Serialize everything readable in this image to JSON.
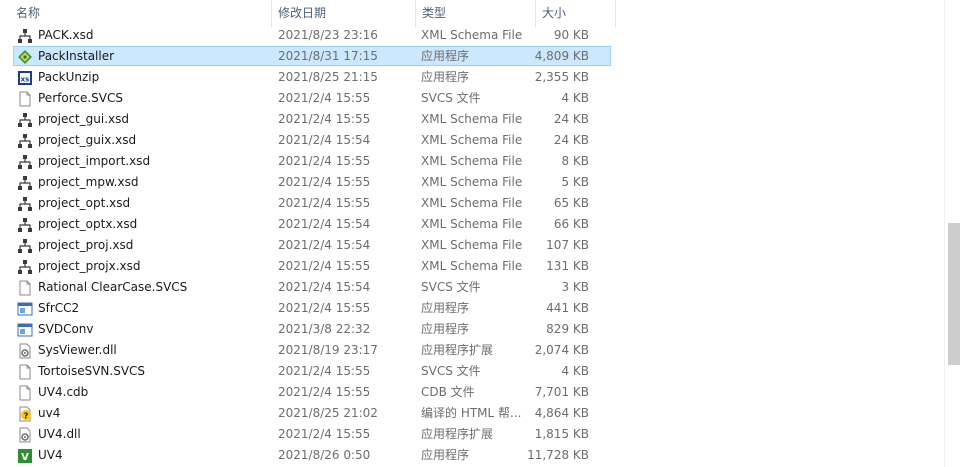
{
  "header": {
    "name_label": "名称",
    "date_label": "修改日期",
    "type_label": "类型",
    "size_label": "大小",
    "sort_indicator": "^"
  },
  "files": [
    {
      "name": "PACK.xsd",
      "date": "2021/8/23 23:16",
      "type": "XML Schema File",
      "size": "90 KB",
      "icon": "xsd-schema-icon"
    },
    {
      "name": "PackInstaller",
      "date": "2021/8/31 17:15",
      "type": "应用程序",
      "size": "4,809 KB",
      "icon": "pack-installer-icon",
      "selected": true
    },
    {
      "name": "PackUnzip",
      "date": "2021/8/25 21:15",
      "type": "应用程序",
      "size": "2,355 KB",
      "icon": "unzip-app-icon"
    },
    {
      "name": "Perforce.SVCS",
      "date": "2021/2/4 15:55",
      "type": "SVCS 文件",
      "size": "4 KB",
      "icon": "blank-file-icon"
    },
    {
      "name": "project_gui.xsd",
      "date": "2021/2/4 15:55",
      "type": "XML Schema File",
      "size": "24 KB",
      "icon": "xsd-schema-icon"
    },
    {
      "name": "project_guix.xsd",
      "date": "2021/2/4 15:54",
      "type": "XML Schema File",
      "size": "24 KB",
      "icon": "xsd-schema-icon"
    },
    {
      "name": "project_import.xsd",
      "date": "2021/2/4 15:55",
      "type": "XML Schema File",
      "size": "8 KB",
      "icon": "xsd-schema-icon"
    },
    {
      "name": "project_mpw.xsd",
      "date": "2021/2/4 15:55",
      "type": "XML Schema File",
      "size": "5 KB",
      "icon": "xsd-schema-icon"
    },
    {
      "name": "project_opt.xsd",
      "date": "2021/2/4 15:55",
      "type": "XML Schema File",
      "size": "65 KB",
      "icon": "xsd-schema-icon"
    },
    {
      "name": "project_optx.xsd",
      "date": "2021/2/4 15:54",
      "type": "XML Schema File",
      "size": "66 KB",
      "icon": "xsd-schema-icon"
    },
    {
      "name": "project_proj.xsd",
      "date": "2021/2/4 15:54",
      "type": "XML Schema File",
      "size": "107 KB",
      "icon": "xsd-schema-icon"
    },
    {
      "name": "project_projx.xsd",
      "date": "2021/2/4 15:55",
      "type": "XML Schema File",
      "size": "131 KB",
      "icon": "xsd-schema-icon"
    },
    {
      "name": "Rational ClearCase.SVCS",
      "date": "2021/2/4 15:54",
      "type": "SVCS 文件",
      "size": "3 KB",
      "icon": "blank-file-icon"
    },
    {
      "name": "SfrCC2",
      "date": "2021/2/4 15:55",
      "type": "应用程序",
      "size": "441 KB",
      "icon": "window-app-icon"
    },
    {
      "name": "SVDConv",
      "date": "2021/3/8 22:32",
      "type": "应用程序",
      "size": "829 KB",
      "icon": "window-app-icon"
    },
    {
      "name": "SysViewer.dll",
      "date": "2021/8/19 23:17",
      "type": "应用程序扩展",
      "size": "2,074 KB",
      "icon": "dll-gear-icon"
    },
    {
      "name": "TortoiseSVN.SVCS",
      "date": "2021/2/4 15:55",
      "type": "SVCS 文件",
      "size": "4 KB",
      "icon": "blank-file-icon"
    },
    {
      "name": "UV4.cdb",
      "date": "2021/2/4 15:55",
      "type": "CDB 文件",
      "size": "7,701 KB",
      "icon": "blank-file-icon"
    },
    {
      "name": "uv4",
      "date": "2021/8/25 21:02",
      "type": "编译的 HTML 帮...",
      "size": "4,864 KB",
      "icon": "help-file-icon"
    },
    {
      "name": "UV4.dll",
      "date": "2021/2/4 15:55",
      "type": "应用程序扩展",
      "size": "1,815 KB",
      "icon": "dll-gear-icon"
    },
    {
      "name": "UV4",
      "date": "2021/8/26 0:50",
      "type": "应用程序",
      "size": "11,728 KB",
      "icon": "uvision-app-icon"
    }
  ],
  "colors": {
    "selection_bg": "#cce8ff",
    "selection_border": "#99d1ff",
    "header_text": "#4c607a",
    "secondary_text": "#6d6d6d"
  }
}
